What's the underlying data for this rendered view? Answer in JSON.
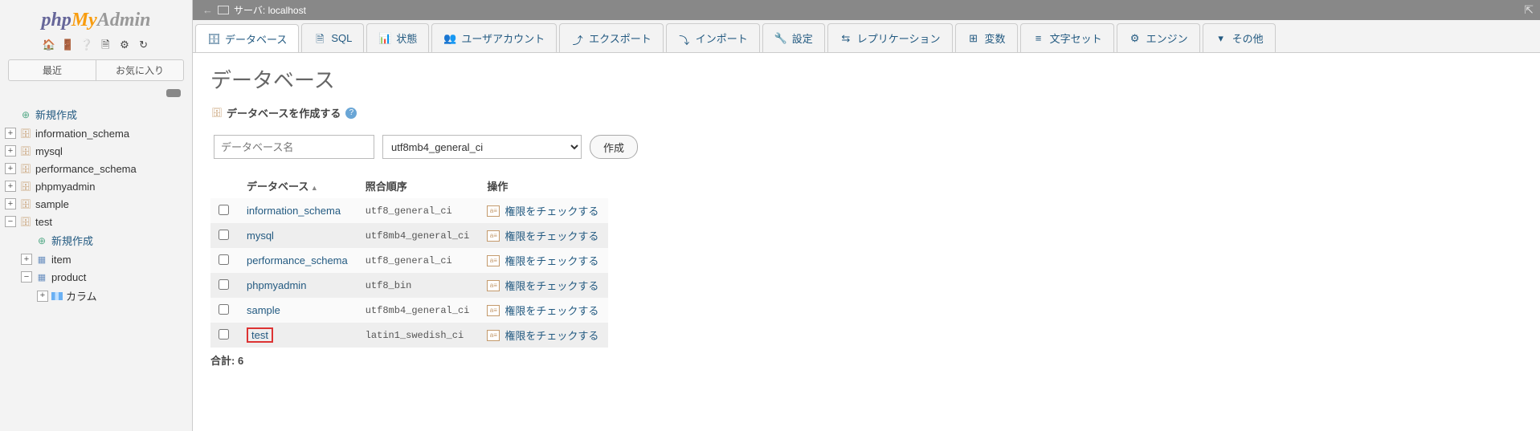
{
  "logo": {
    "php": "php",
    "my": "My",
    "admin": "Admin"
  },
  "sidebar": {
    "recent": "最近",
    "favorite": "お気に入り",
    "new_label": "新規作成",
    "databases": [
      {
        "name": "information_schema",
        "expandable": true
      },
      {
        "name": "mysql",
        "expandable": true
      },
      {
        "name": "performance_schema",
        "expandable": true
      },
      {
        "name": "phpmyadmin",
        "expandable": true
      },
      {
        "name": "sample",
        "expandable": true
      },
      {
        "name": "test",
        "expandable": true,
        "expanded": true
      }
    ],
    "test_children": {
      "new": "新規作成",
      "item": "item",
      "product": "product",
      "column": "カラム"
    }
  },
  "breadcrumb": {
    "server": "サーバ:",
    "host": "localhost"
  },
  "tabs": {
    "databases": "データベース",
    "sql": "SQL",
    "status": "状態",
    "users": "ユーザアカウント",
    "export": "エクスポート",
    "import": "インポート",
    "settings": "設定",
    "replication": "レプリケーション",
    "variables": "変数",
    "charsets": "文字セット",
    "engines": "エンジン",
    "more": "その他"
  },
  "main": {
    "title": "データベース",
    "create_label": "データベースを作成する",
    "dbname_placeholder": "データベース名",
    "collation_selected": "utf8mb4_general_ci",
    "create_button": "作成",
    "columns": {
      "db": "データベース",
      "collation": "照合順序",
      "ops": "操作"
    },
    "op_label": "権限をチェックする",
    "rows": [
      {
        "name": "information_schema",
        "collation": "utf8_general_ci"
      },
      {
        "name": "mysql",
        "collation": "utf8mb4_general_ci"
      },
      {
        "name": "performance_schema",
        "collation": "utf8_general_ci"
      },
      {
        "name": "phpmyadmin",
        "collation": "utf8_bin"
      },
      {
        "name": "sample",
        "collation": "utf8mb4_general_ci"
      },
      {
        "name": "test",
        "collation": "latin1_swedish_ci",
        "highlight": true
      }
    ],
    "total_label": "合計:",
    "total_count": "6"
  }
}
